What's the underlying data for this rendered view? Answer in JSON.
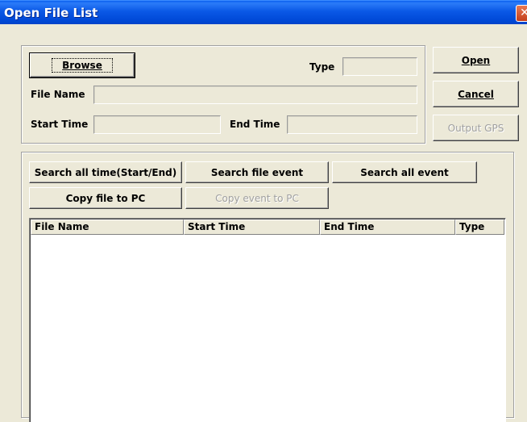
{
  "window": {
    "title": "Open File List",
    "close_glyph": "✕"
  },
  "top_group": {
    "browse_label": "Browse",
    "type_label": "Type",
    "type_value": "",
    "file_name_label": "File Name",
    "file_name_value": "",
    "start_time_label": "Start Time",
    "start_time_value": "",
    "end_time_label": "End Time",
    "end_time_value": ""
  },
  "side_buttons": {
    "open_label": "Open",
    "cancel_label": "Cancel",
    "output_gps_label": "Output GPS"
  },
  "search_group": {
    "search_all_time_label": "Search all time(Start/End)",
    "search_file_event_label": "Search file event",
    "search_all_event_label": "Search all event",
    "copy_file_label": "Copy file to PC",
    "copy_event_label": "Copy event to PC"
  },
  "list": {
    "columns": [
      "File Name",
      "Start Time",
      "End Time",
      "Type"
    ],
    "rows": []
  },
  "colors": {
    "titlebar": "#0a58e6",
    "dialog_bg": "#ece9d8",
    "close_button": "#c43e1a"
  }
}
